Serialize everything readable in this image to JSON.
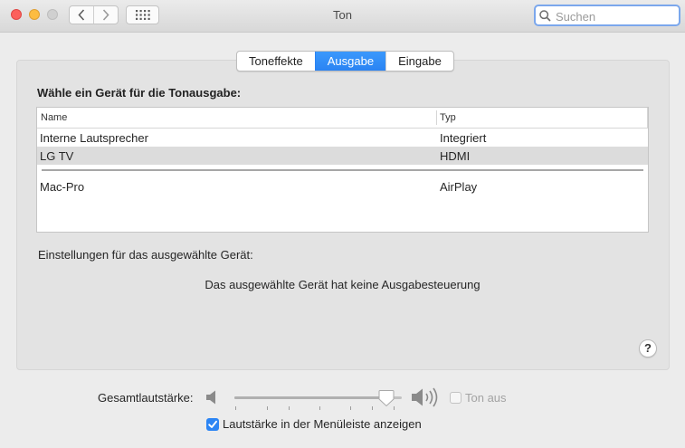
{
  "window": {
    "title": "Ton"
  },
  "toolbar": {
    "back_icon": "chevron-left-icon",
    "forward_icon": "chevron-right-icon",
    "grid_icon": "show-all-grid-icon"
  },
  "search": {
    "placeholder": "Suchen",
    "value": ""
  },
  "tabs": [
    {
      "label": "Toneffekte",
      "active": false
    },
    {
      "label": "Ausgabe",
      "active": true
    },
    {
      "label": "Eingabe",
      "active": false
    }
  ],
  "output": {
    "heading": "Wähle ein Gerät für die Tonausgabe:",
    "columns": {
      "name": "Name",
      "type": "Typ"
    },
    "devices": [
      {
        "name": "Interne Lautsprecher",
        "type": "Integriert",
        "selected": false
      },
      {
        "name": "LG TV",
        "type": "HDMI",
        "selected": true
      },
      {
        "name": "Mac-Pro",
        "type": "AirPlay",
        "selected": false
      }
    ],
    "settings_label": "Einstellungen für das ausgewählte Gerät:",
    "no_controls_text": "Das ausgewählte Gerät hat keine Ausgabesteuerung",
    "help_label": "?"
  },
  "volume": {
    "label": "Gesamtlautstärke:",
    "level_fraction": 0.95,
    "mute_label": "Ton aus",
    "mute_checked": false,
    "mute_enabled": false,
    "show_in_menu_bar_label": "Lautstärke in der Menüleiste anzeigen",
    "show_in_menu_bar_checked": true
  },
  "colors": {
    "accent": "#2a83f3",
    "close": "#fc605c",
    "minimize": "#fdbc40",
    "zoom_disabled": "#d0d0d0"
  }
}
